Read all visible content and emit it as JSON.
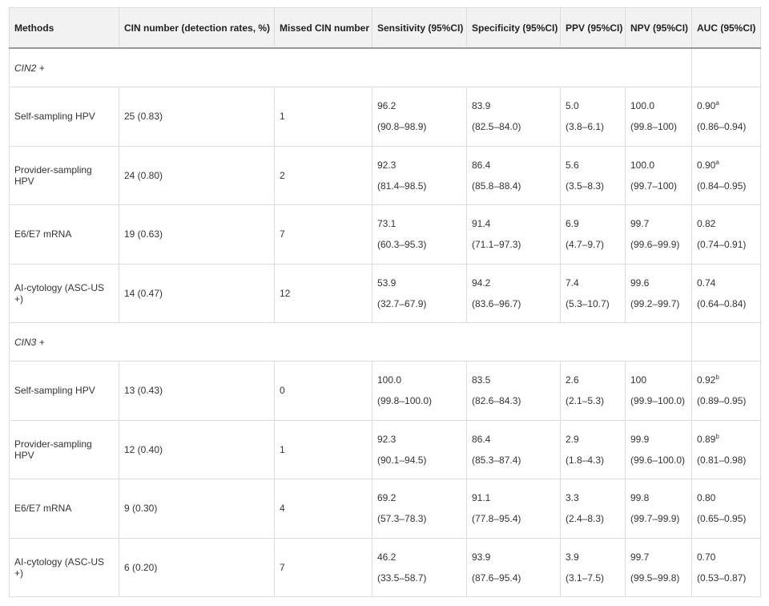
{
  "table": {
    "headers": [
      "Methods",
      "CIN number (detection rates, %)",
      "Missed CIN number",
      "Sensitivity (95%CI)",
      "Specificity (95%CI)",
      "PPV (95%CI)",
      "NPV (95%CI)",
      "AUC (95%CI)"
    ],
    "groups": [
      {
        "label": "CIN2 +",
        "rows": [
          {
            "method": "Self-sampling HPV",
            "cin": "25 (0.83)",
            "missed": "1",
            "sens": [
              "96.2",
              "(90.8–98.9)"
            ],
            "spec": [
              "83.9",
              "(82.5–84.0)"
            ],
            "ppv": [
              "5.0",
              "(3.8–6.1)"
            ],
            "npv": [
              "100.0",
              "(99.8–100)"
            ],
            "auc": [
              "0.90",
              "(0.86–0.94)"
            ],
            "auc_sup": "a"
          },
          {
            "method": "Provider-sampling HPV",
            "cin": "24 (0.80)",
            "missed": "2",
            "sens": [
              "92.3",
              "(81.4–98.5)"
            ],
            "spec": [
              "86.4",
              "(85.8–88.4)"
            ],
            "ppv": [
              "5.6",
              "(3.5–8.3)"
            ],
            "npv": [
              "100.0",
              "(99.7–100)"
            ],
            "auc": [
              "0.90",
              "(0.84–0.95)"
            ],
            "auc_sup": "a"
          },
          {
            "method": "E6/E7 mRNA",
            "cin": "19 (0.63)",
            "missed": "7",
            "sens": [
              "73.1",
              "(60.3–95.3)"
            ],
            "spec": [
              "91.4",
              "(71.1–97.3)"
            ],
            "ppv": [
              "6.9",
              "(4.7–9.7)"
            ],
            "npv": [
              "99.7",
              "(99.6–99.9)"
            ],
            "auc": [
              "0.82",
              "(0.74–0.91)"
            ],
            "auc_sup": ""
          },
          {
            "method": "AI-cytology (ASC-US +)",
            "cin": "14 (0.47)",
            "missed": "12",
            "sens": [
              "53.9",
              "(32.7–67.9)"
            ],
            "spec": [
              "94.2",
              "(83.6–96.7)"
            ],
            "ppv": [
              "7.4",
              "(5.3–10.7)"
            ],
            "npv": [
              "99.6",
              "(99.2–99.7)"
            ],
            "auc": [
              "0.74",
              "(0.64–0.84)"
            ],
            "auc_sup": ""
          }
        ]
      },
      {
        "label": "CIN3 +",
        "rows": [
          {
            "method": "Self-sampling HPV",
            "cin": "13 (0.43)",
            "missed": "0",
            "sens": [
              "100.0",
              "(99.8–100.0)"
            ],
            "spec": [
              "83.5",
              "(82.6–84.3)"
            ],
            "ppv": [
              "2.6",
              "(2.1–5.3)"
            ],
            "npv": [
              "100",
              "(99.9–100.0)"
            ],
            "auc": [
              "0.92",
              "(0.89–0.95)"
            ],
            "auc_sup": "b"
          },
          {
            "method": "Provider-sampling HPV",
            "cin": "12 (0.40)",
            "missed": "1",
            "sens": [
              "92.3",
              "(90.1–94.5)"
            ],
            "spec": [
              "86.4",
              "(85.3–87.4)"
            ],
            "ppv": [
              "2.9",
              "(1.8–4.3)"
            ],
            "npv": [
              "99.9",
              "(99.6–100.0)"
            ],
            "auc": [
              "0.89",
              "(0.81–0.98)"
            ],
            "auc_sup": "b"
          },
          {
            "method": "E6/E7 mRNA",
            "cin": "9 (0.30)",
            "missed": "4",
            "sens": [
              "69.2",
              "(57.3–78.3)"
            ],
            "spec": [
              "91.1",
              "(77.8–95.4)"
            ],
            "ppv": [
              "3.3",
              "(2.4–8.3)"
            ],
            "npv": [
              "99.8",
              "(99.7–99.9)"
            ],
            "auc": [
              "0.80",
              "(0.65–0.95)"
            ],
            "auc_sup": ""
          },
          {
            "method": "AI-cytology (ASC-US +)",
            "cin": "6 (0.20)",
            "missed": "7",
            "sens": [
              "46.2",
              "(33.5–58.7)"
            ],
            "spec": [
              "93.9",
              "(87.6–95.4)"
            ],
            "ppv": [
              "3.9",
              "(3.1–7.5)"
            ],
            "npv": [
              "99.7",
              "(99.5–99.8)"
            ],
            "auc": [
              "0.70",
              "(0.53–0.87)"
            ],
            "auc_sup": ""
          }
        ]
      }
    ]
  }
}
